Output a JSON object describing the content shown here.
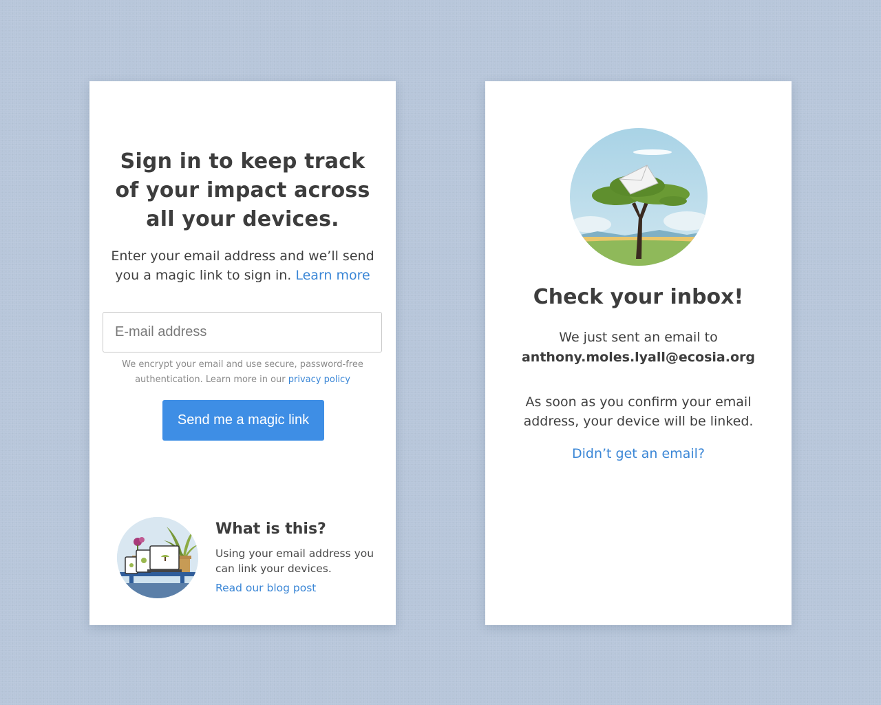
{
  "signin": {
    "heading": "Sign in to keep track of your impact across all your devices.",
    "subtitle": "Enter your email address and we’ll send you a magic link to sign in.",
    "learn_more": "Learn more",
    "email_placeholder": "E-mail address",
    "encrypt_note": "We encrypt your email and use secure, password-free authentication. Learn more in our",
    "privacy_link": "privacy policy",
    "button_label": "Send me a magic link",
    "whatis_title": "What is this?",
    "whatis_body": "Using your email address you can link your devices.",
    "whatis_link": "Read our blog post"
  },
  "inbox": {
    "title": "Check your inbox!",
    "sent_text": "We just sent an email to",
    "email": "anthony.moles.lyall@ecosia.org",
    "confirm_text": "As soon as you confirm your email address, your device will be linked.",
    "resend_link": "Didn’t get an email?"
  },
  "colors": {
    "background": "#b7c6da",
    "accent": "#3e8ee5",
    "link": "#3a86d6"
  },
  "icons": {
    "devices_illustration": "devices-on-table-illustration",
    "inbox_illustration": "envelope-in-acacia-tree-illustration"
  }
}
